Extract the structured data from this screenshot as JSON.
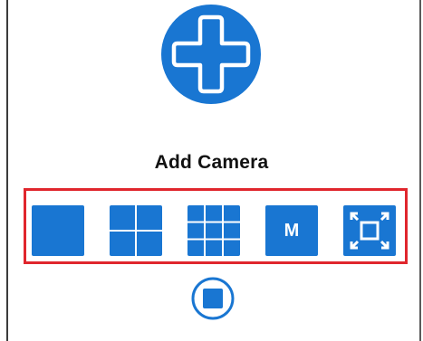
{
  "add_camera": {
    "label": "Add Camera",
    "icon": "plus-icon"
  },
  "layout_toolbar": {
    "buttons": [
      {
        "name": "single-view",
        "icon": "single-view-icon"
      },
      {
        "name": "four-split",
        "icon": "four-split-icon"
      },
      {
        "name": "nine-split",
        "icon": "nine-split-icon"
      },
      {
        "name": "manual",
        "icon": "manual-icon",
        "label": "M"
      },
      {
        "name": "fullscreen",
        "icon": "fullscreen-icon"
      }
    ]
  },
  "stop": {
    "icon": "stop-icon"
  },
  "colors": {
    "accent": "#1976d2",
    "highlight_border": "#e0262d",
    "label_text": "#111111"
  }
}
